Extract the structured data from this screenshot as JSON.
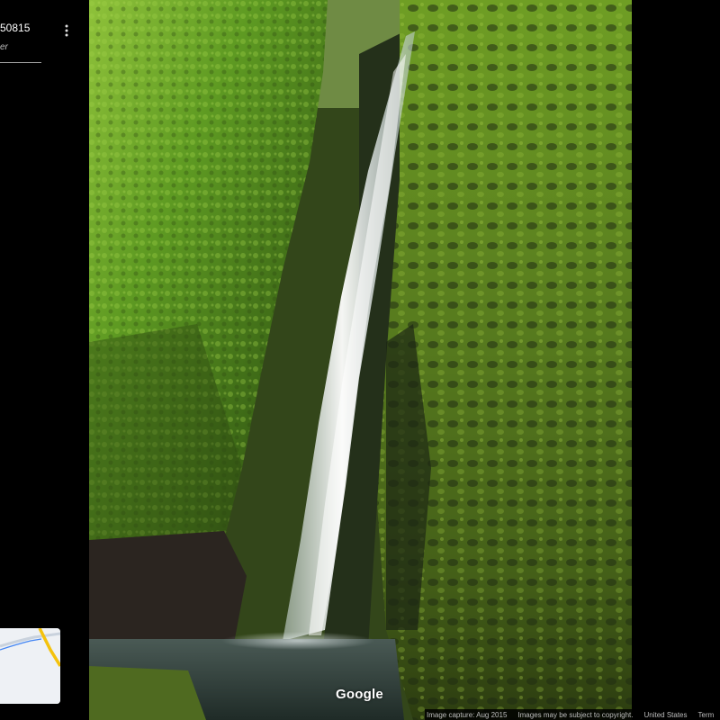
{
  "header": {
    "title": "50815",
    "subtitle": "er",
    "menu_icon": "more-vert-icon"
  },
  "photo": {
    "logo_text": "Google"
  },
  "minimap": {
    "route_color": "#f4c20d",
    "road_color": "#4285f4"
  },
  "footer": {
    "capture": "Image capture: Aug 2015",
    "copyright": "Images may be subject to copyright.",
    "region": "United States",
    "terms": "Term"
  },
  "colors": {
    "background": "#000000",
    "moss_bright": "#7cb02a",
    "moss_dark": "#2f4a12",
    "water": "#eef6f8"
  }
}
